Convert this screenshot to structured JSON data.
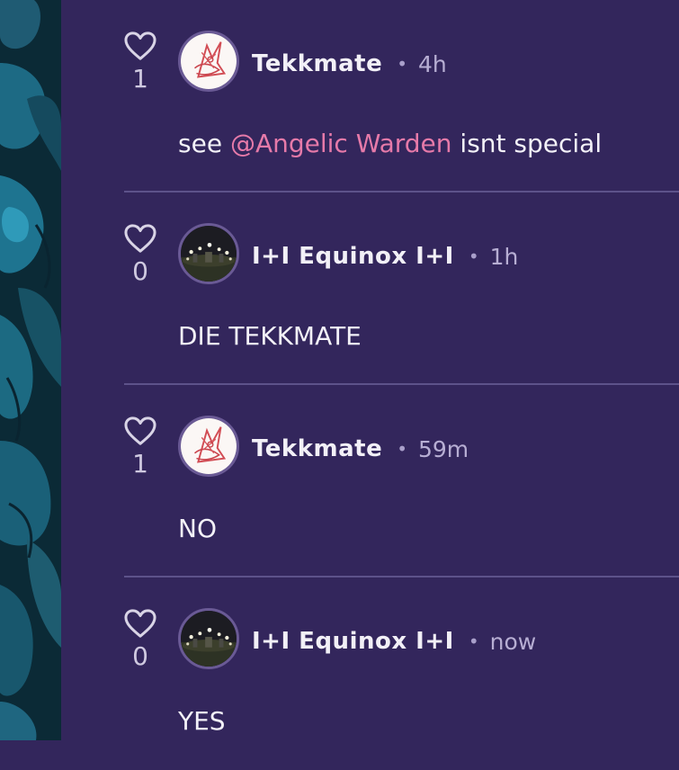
{
  "colors": {
    "background": "#33265c",
    "divider": "#5d528a",
    "mention": "#e67aa9",
    "timestamp": "#b7aed3",
    "side_panel": "#0c2f3c"
  },
  "comments": [
    {
      "likes": "1",
      "author": "Tekkmate",
      "separator": "•",
      "time": "4h",
      "text_before": "see ",
      "mention": "@Angelic Warden",
      "text_after": " isnt special",
      "avatar": "tekkmate-avatar"
    },
    {
      "likes": "0",
      "author": "I+I Equinox I+I",
      "separator": "•",
      "time": "1h",
      "text": "DIE TEKKMATE",
      "avatar": "equinox-avatar"
    },
    {
      "likes": "1",
      "author": "Tekkmate",
      "separator": "•",
      "time": "59m",
      "text": "NO",
      "avatar": "tekkmate-avatar"
    },
    {
      "likes": "0",
      "author": "I+I Equinox I+I",
      "separator": "•",
      "time": "now",
      "text": "YES",
      "avatar": "equinox-avatar"
    }
  ]
}
